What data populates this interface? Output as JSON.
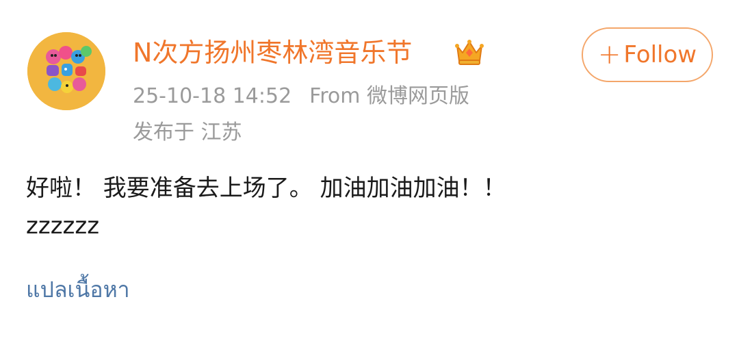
{
  "post": {
    "username": "N次方扬州枣林湾音乐节",
    "verified_icon": "crown-icon",
    "follow_label": "Follow",
    "follow_icon": "plus-icon",
    "timestamp": "25-10-18 14:52",
    "source": "From 微博网页版",
    "location": "发布于 江苏",
    "content_line1": "好啦！ 我要准备去上场了。 加油加油加油！！",
    "content_line2": "zzzzzz",
    "translate_label": "แปลเนื้อหา"
  },
  "colors": {
    "username": "#f0762b",
    "follow_border": "#f4a66a",
    "meta": "#9a9a9a",
    "content": "#1a1a1a",
    "translate_link": "#4e77a6",
    "avatar_bg": "#f2b640"
  }
}
